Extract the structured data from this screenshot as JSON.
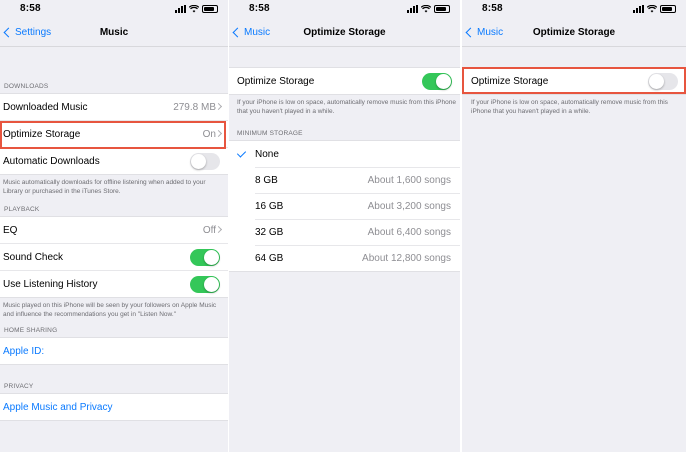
{
  "status_time": "8:58",
  "screen1": {
    "back_label": "Settings",
    "title": "Music",
    "downloads_header": "DOWNLOADS",
    "downloaded_music_label": "Downloaded Music",
    "downloaded_music_value": "279.8 MB",
    "optimize_storage_label": "Optimize Storage",
    "optimize_storage_value": "On",
    "automatic_downloads_label": "Automatic Downloads",
    "automatic_downloads_on": false,
    "downloads_footer": "Music automatically downloads for offline listening when added to your Library or purchased in the iTunes Store.",
    "playback_header": "PLAYBACK",
    "eq_label": "EQ",
    "eq_value": "Off",
    "sound_check_label": "Sound Check",
    "sound_check_on": true,
    "listening_history_label": "Use Listening History",
    "listening_history_on": true,
    "playback_footer": "Music played on this iPhone will be seen by your followers on Apple Music and influence the recommendations you get in \"Listen Now.\"",
    "home_sharing_header": "HOME SHARING",
    "apple_id_label": "Apple ID:",
    "privacy_header": "PRIVACY",
    "privacy_link": "Apple Music and Privacy"
  },
  "screen2": {
    "back_label": "Music",
    "title": "Optimize Storage",
    "toggle_label": "Optimize Storage",
    "toggle_on": true,
    "footer": "If your iPhone is low on space, automatically remove music from this iPhone that you haven't played in a while.",
    "min_storage_header": "MINIMUM STORAGE",
    "options": [
      {
        "label": "None",
        "value": "",
        "selected": true
      },
      {
        "label": "8 GB",
        "value": "About 1,600 songs",
        "selected": false
      },
      {
        "label": "16 GB",
        "value": "About 3,200 songs",
        "selected": false
      },
      {
        "label": "32 GB",
        "value": "About 6,400 songs",
        "selected": false
      },
      {
        "label": "64 GB",
        "value": "About 12,800 songs",
        "selected": false
      }
    ]
  },
  "screen3": {
    "back_label": "Music",
    "title": "Optimize Storage",
    "toggle_label": "Optimize Storage",
    "toggle_on": false,
    "footer": "If your iPhone is low on space, automatically remove music from this iPhone that you haven't played in a while."
  },
  "colors": {
    "accent": "#0a7aff",
    "toggle_on": "#34c759",
    "highlight": "#e7553f"
  }
}
